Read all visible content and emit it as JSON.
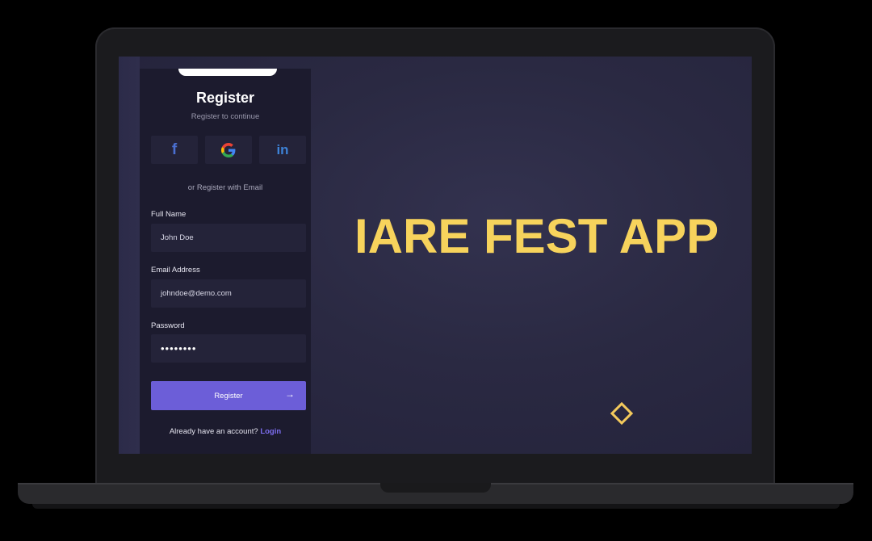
{
  "register": {
    "title": "Register",
    "subtitle": "Register to continue",
    "social": {
      "facebook_icon": "facebook-icon",
      "google_icon": "google-icon",
      "linkedin_icon": "linkedin-icon",
      "facebook_glyph": "f",
      "linkedin_glyph": "in"
    },
    "divider": "or Register with Email",
    "fields": {
      "full_name_label": "Full Name",
      "full_name_value": "John Doe",
      "email_label": "Email Address",
      "email_value": "johndoe@demo.com",
      "password_label": "Password",
      "password_value": "••••••••"
    },
    "submit_label": "Register",
    "submit_arrow": "→",
    "login_prompt": "Already have an account?",
    "login_link": "Login"
  },
  "hero": {
    "headline": "IARE FEST APP",
    "decoration": "diamond-outline"
  },
  "colors": {
    "accent": "#6c5ed8",
    "headline": "#f7d35c",
    "panel_bg": "#1c1b2e"
  }
}
